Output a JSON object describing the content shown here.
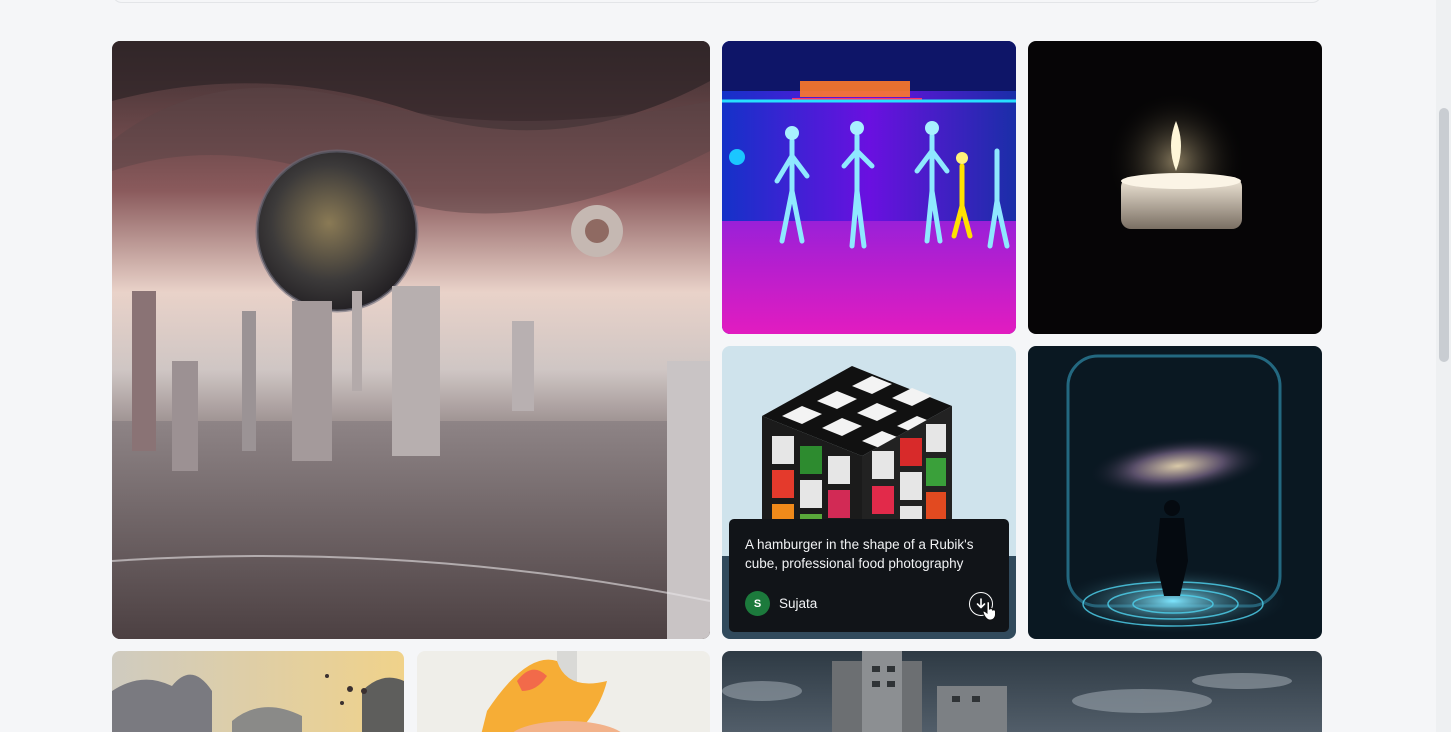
{
  "gallery": {
    "tiles": [
      {
        "key": "world",
        "alt_icon": "image-icon"
      },
      {
        "key": "dance",
        "alt_icon": "image-icon"
      },
      {
        "key": "candle",
        "alt_icon": "image-icon"
      },
      {
        "key": "cube",
        "alt_icon": "image-icon"
      },
      {
        "key": "space",
        "alt_icon": "image-icon"
      },
      {
        "key": "mountain",
        "alt_icon": "image-icon"
      },
      {
        "key": "cat",
        "alt_icon": "image-icon"
      },
      {
        "key": "city",
        "alt_icon": "image-icon"
      }
    ]
  },
  "tooltip": {
    "prompt": "A hamburger in the shape of a Rubik's cube, professional food photography",
    "author_initial": "S",
    "author_name": "Sujata",
    "download_icon": "download-icon"
  },
  "colors": {
    "background": "#f5f6f8",
    "tooltip_bg": "#111418",
    "avatar_bg": "#1c7a3c"
  }
}
